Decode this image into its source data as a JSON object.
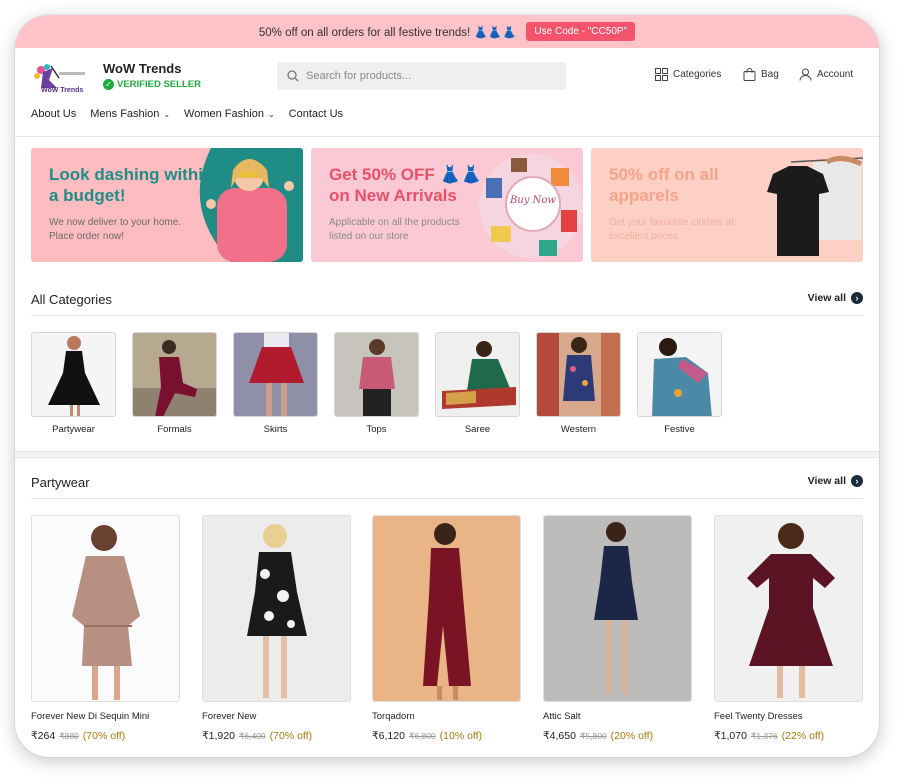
{
  "promo": {
    "text": "50% off on all orders for all festive trends! 👗👗👗",
    "code": "Use Code - \"CC50P\""
  },
  "store": {
    "logo_text": "WoW Trends",
    "name": "WoW Trends",
    "badge": "VERIFIED SELLER"
  },
  "search": {
    "placeholder": "Search for products..."
  },
  "actions": {
    "categories": "Categories",
    "bag": "Bag",
    "account": "Account"
  },
  "nav": [
    "About Us",
    "Mens Fashion",
    "Women Fashion",
    "Contact Us"
  ],
  "banners": [
    {
      "title": "Look dashing within a budget!",
      "subtitle": "We now deliver to your home. Place order now!",
      "bg": "#fdbdc0",
      "title_color": "#1f8d86",
      "sub_color": "#6a6a6a"
    },
    {
      "title": "Get 50% OFF 👗👗 on New Arrivals",
      "subtitle": "Applicable on all the products listed on our store",
      "badge": "Buy Now",
      "bg": "#fbc9d3",
      "title_color": "#e8506c",
      "sub_color": "#8a8a8a"
    },
    {
      "title": "50% off on all apparels",
      "subtitle": "Get your favourite clothes at excellent prices.",
      "bg": "#fdd0c6",
      "title_color": "#f6a38a",
      "sub_color": "#eeb1a1"
    }
  ],
  "categories_section": {
    "title": "All Categories",
    "view_all": "View all"
  },
  "categories": [
    "Partywear",
    "Formals",
    "Skirts",
    "Tops",
    "Saree",
    "Western",
    "Festive"
  ],
  "products_section": {
    "title": "Partywear",
    "view_all": "View all"
  },
  "products": [
    {
      "name": "Forever New Di Sequin Mini",
      "price": "₹264",
      "mrp": "₹880",
      "off": "(70% off)"
    },
    {
      "name": "Forever New",
      "price": "₹1,920",
      "mrp": "₹6,400",
      "off": "(70% off)"
    },
    {
      "name": "Torqadorn",
      "price": "₹6,120",
      "mrp": "₹6,800",
      "off": "(10% off)"
    },
    {
      "name": "Attic Salt",
      "price": "₹4,650",
      "mrp": "₹5,800",
      "off": "(20% off)"
    },
    {
      "name": "Feel Twenty Dresses",
      "price": "₹1,070",
      "mrp": "₹1,376",
      "off": "(22% off)"
    }
  ],
  "colors": {
    "promo_bg": "#fdc3c8",
    "code_bg": "#f4546b",
    "verified": "#1eaa3c",
    "discount": "#a8790a",
    "accent_dark": "#1c2b3a"
  }
}
